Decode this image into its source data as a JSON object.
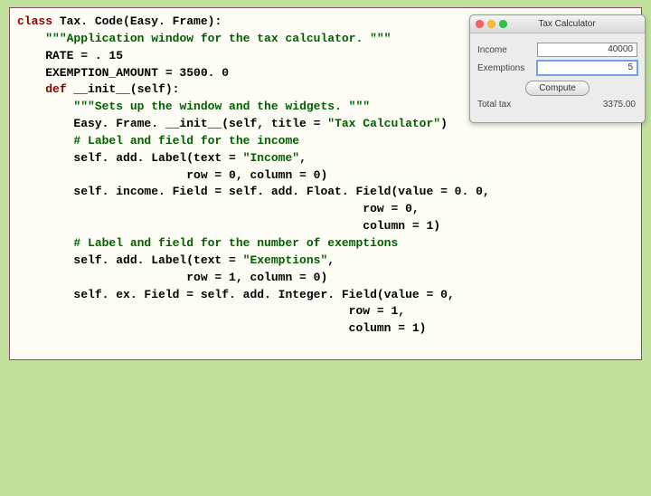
{
  "code": {
    "l01a": "class",
    "l01b": " Tax. Code(Easy. Frame):",
    "l02a": "    ",
    "l02b": "\"\"\"Application window for the tax calculator. \"\"\"",
    "l03": "",
    "l04": "    RATE = . 15",
    "l05": "    EXEMPTION_AMOUNT = 3500. 0",
    "l06": "",
    "l07a": "    ",
    "l07b": "def",
    "l07c": " __init__(self):",
    "l08a": "        ",
    "l08b": "\"\"\"Sets up the window and the widgets. \"\"\"",
    "l09a": "        Easy. Frame. __init__(self, title = ",
    "l09b": "\"Tax Calculator\"",
    "l09c": ")",
    "l10": "",
    "l11a": "        ",
    "l11b": "# Label and field for the income",
    "l12a": "        self. add. Label(text = ",
    "l12b": "\"Income\"",
    "l12c": ",",
    "l13": "                        row = 0, column = 0)",
    "l14": "        self. income. Field = self. add. Float. Field(value = 0. 0,",
    "l15": "                                                 row = 0,",
    "l16": "                                                 column = 1)",
    "l17": "",
    "l18a": "        ",
    "l18b": "# Label and field for the number of exemptions",
    "l19a": "        self. add. Label(text = ",
    "l19b": "\"Exemptions\"",
    "l19c": ",",
    "l20": "                        row = 1, column = 0)",
    "l21": "        self. ex. Field = self. add. Integer. Field(value = 0,",
    "l22": "                                               row = 1,",
    "l23": "                                               column = 1)"
  },
  "window": {
    "title": "Tax Calculator",
    "rows": {
      "income_label": "Income",
      "income_value": "40000",
      "exemptions_label": "Exemptions",
      "exemptions_value": "5",
      "total_label": "Total tax",
      "total_value": "3375.00"
    },
    "compute_label": "Compute"
  }
}
